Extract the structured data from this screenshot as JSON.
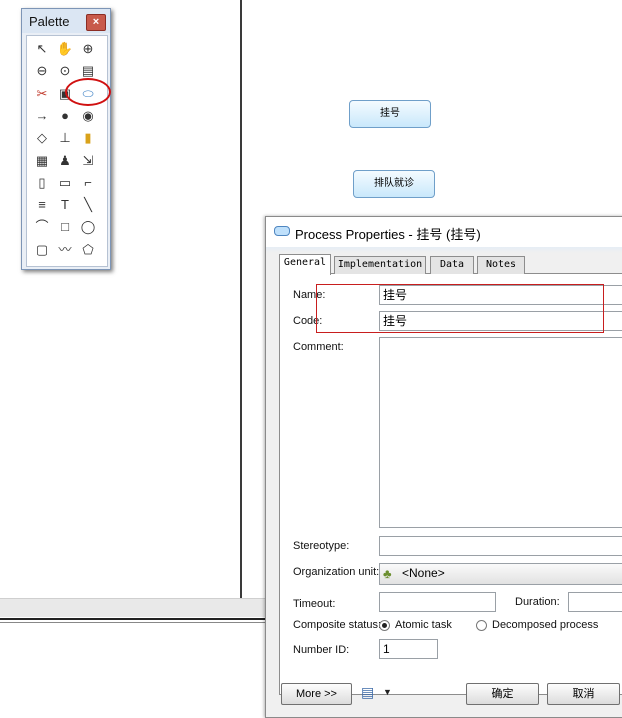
{
  "palette": {
    "title": "Palette",
    "close_glyph": "×",
    "tools": [
      {
        "name": "pointer-icon",
        "glyph": "↖"
      },
      {
        "name": "hand-icon",
        "glyph": "✋"
      },
      {
        "name": "zoom-in-icon",
        "glyph": "⊕"
      },
      {
        "name": "zoom-out-icon",
        "glyph": "⊖"
      },
      {
        "name": "zoom-fit-icon",
        "glyph": "⊙"
      },
      {
        "name": "properties-icon",
        "glyph": "▤"
      },
      {
        "name": "cut-icon",
        "glyph": "✂"
      },
      {
        "name": "package-icon",
        "glyph": "▣"
      },
      {
        "name": "process-tool-icon",
        "glyph": "⬭"
      },
      {
        "name": "flow-icon",
        "glyph": "→"
      },
      {
        "name": "start-icon",
        "glyph": "●"
      },
      {
        "name": "end-icon",
        "glyph": "◉"
      },
      {
        "name": "decision-icon",
        "glyph": "◇"
      },
      {
        "name": "synchronization-icon",
        "glyph": "⊥"
      },
      {
        "name": "data-store-icon",
        "glyph": "▮"
      },
      {
        "name": "organization-unit-icon",
        "glyph": "▦"
      },
      {
        "name": "actor-icon",
        "glyph": "♟"
      },
      {
        "name": "message-icon",
        "glyph": "⇲"
      },
      {
        "name": "file-icon",
        "glyph": "▯"
      },
      {
        "name": "note-icon",
        "glyph": "▭"
      },
      {
        "name": "link-icon",
        "glyph": "⌐"
      },
      {
        "name": "text-tool-icon",
        "glyph": "≡"
      },
      {
        "name": "title-icon",
        "glyph": "T"
      },
      {
        "name": "line-icon",
        "glyph": "╲"
      },
      {
        "name": "arc-icon",
        "glyph": "⌒"
      },
      {
        "name": "rectangle-icon",
        "glyph": "□"
      },
      {
        "name": "ellipse-icon",
        "glyph": "◯"
      },
      {
        "name": "rounded-rectangle-icon",
        "glyph": "▢"
      },
      {
        "name": "polyline-icon",
        "glyph": "〰"
      },
      {
        "name": "polygon-icon",
        "glyph": "⬠"
      }
    ]
  },
  "canvas": {
    "process1": "挂号",
    "process2": "排队就诊"
  },
  "dialog": {
    "title": "Process Properties - 挂号 (挂号)",
    "tabs": [
      "General",
      "Implementation",
      "Data",
      "Notes"
    ],
    "labels": {
      "name": "Name:",
      "code": "Code:",
      "comment": "Comment:",
      "stereotype": "Stereotype:",
      "organization_unit": "Organization unit:",
      "timeout": "Timeout:",
      "duration": "Duration:",
      "composite_status": "Composite status:",
      "number_id": "Number ID:"
    },
    "values": {
      "name": "挂号",
      "code": "挂号",
      "comment": "",
      "stereotype": "",
      "organization_unit": "<None>",
      "timeout": "",
      "duration": "",
      "number_id": "1"
    },
    "radio": {
      "atomic": "Atomic task",
      "decomposed": "Decomposed process",
      "selected": "Atomic task"
    },
    "buttons": {
      "more": "More >>",
      "ok": "确定",
      "cancel": "取消"
    }
  }
}
